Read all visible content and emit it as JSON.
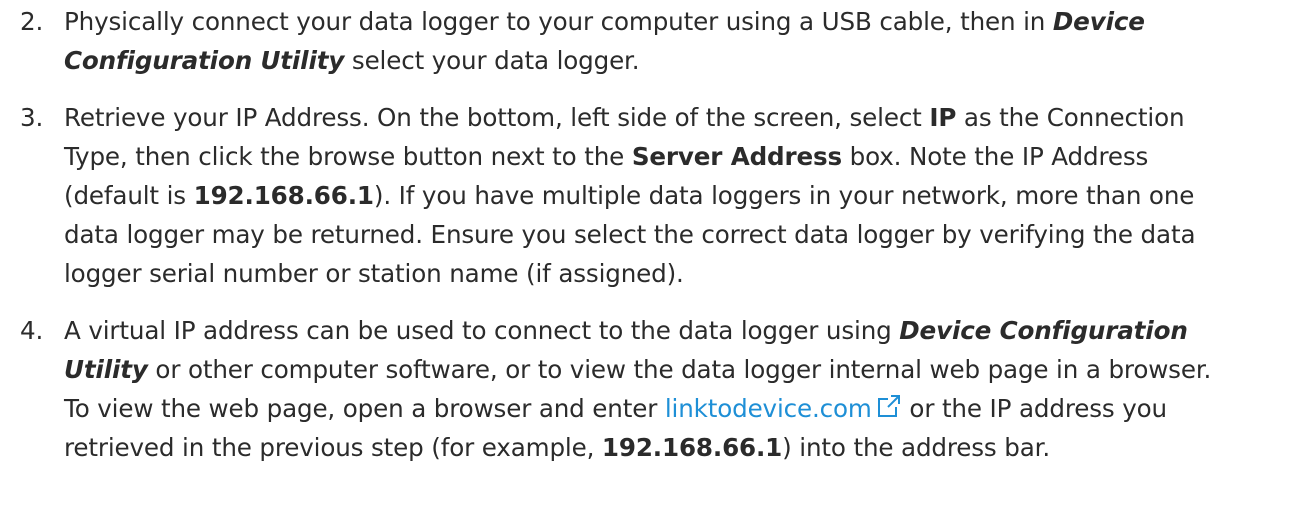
{
  "steps": [
    {
      "number": "2.",
      "t1": "Physically connect your data logger to your computer using a USB cable, then in ",
      "app1": "Device Configuration Utility",
      "t2": " select your data logger."
    },
    {
      "number": "3.",
      "t1": "Retrieve your IP Address. On the bottom, left side of the screen, select ",
      "b1": "IP",
      "t2": " as the Connection Type, then click the browse button next to the ",
      "b2": "Server Address",
      "t3": " box. Note the IP Address (default is ",
      "b3": "192.168.66.1",
      "t4": "). If you have multiple data loggers in your network, more than one data logger may be returned. Ensure you select the correct data logger by verifying the data logger serial number or station name (if assigned)."
    },
    {
      "number": "4.",
      "t1": "A virtual IP address can be used to connect to the data logger using ",
      "app1": "Device Configuration Utility",
      "t2": " or other computer software, or to view the data logger internal web page in a browser. To view the web page, open a browser and enter ",
      "link": "linktodevice.com",
      "link_icon": "external-link-icon",
      "t3": " or the IP address you retrieved in the previous step (for example, ",
      "b1": "192.168.66.1",
      "t4": ") into the address bar."
    }
  ],
  "colors": {
    "text": "#2b2b2b",
    "link": "#1e8fd6"
  }
}
